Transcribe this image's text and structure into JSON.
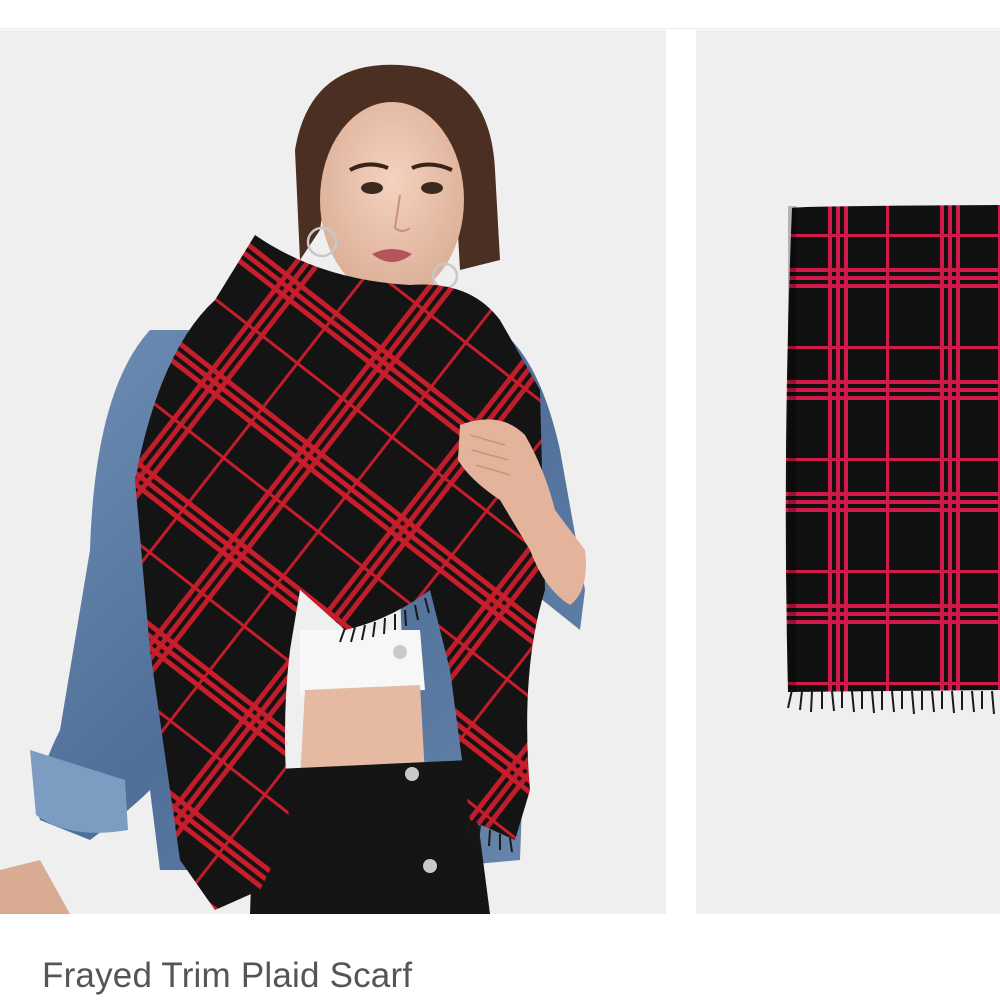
{
  "product": {
    "title": "Frayed Trim Plaid Scarf"
  },
  "gallery": {
    "images": [
      {
        "name": "model-wearing-scarf",
        "depicts": "woman wearing red and black plaid scarf over denim jacket"
      },
      {
        "name": "scarf-folded-detail",
        "depicts": "folded red and black plaid scarf with frayed fringe"
      }
    ],
    "background_color": "#eeeeee"
  },
  "colors": {
    "plaid_red": "#d01f2e",
    "plaid_black": "#141414",
    "denim": "#5c7fa8",
    "title_text": "#555555"
  }
}
